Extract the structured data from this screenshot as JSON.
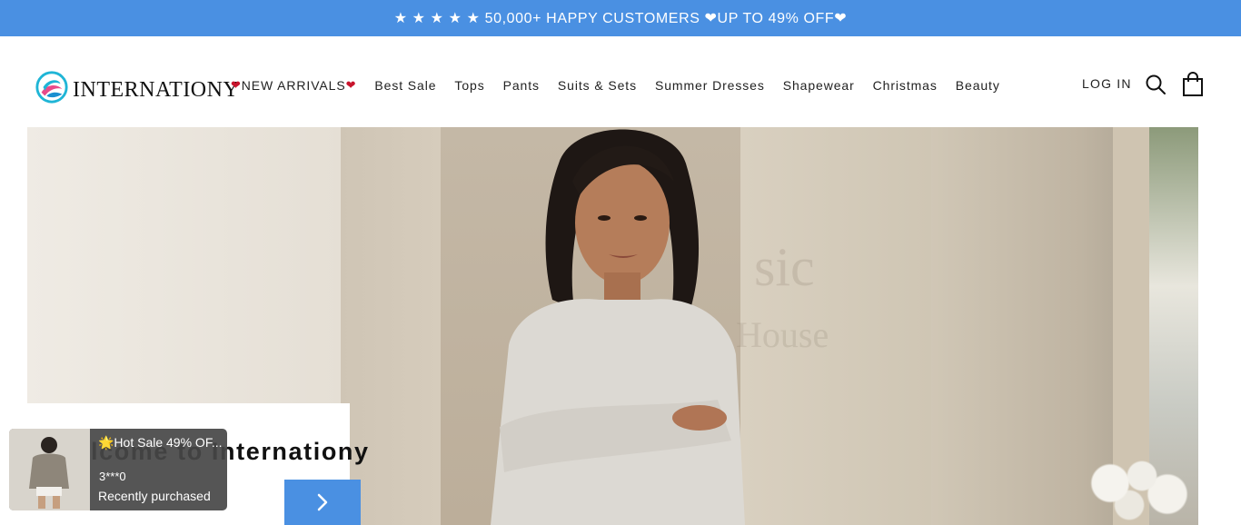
{
  "announcement": {
    "text": "★ ★ ★ ★ ★ 50,000+ HAPPY CUSTOMERS ❤UP TO 49% OFF❤"
  },
  "header": {
    "logo_text": "INTERNATIONY",
    "nav": [
      {
        "label": "NEW ARRIVALS",
        "heart_left": "❤",
        "heart_right": "❤"
      },
      {
        "label": "Best Sale"
      },
      {
        "label": "Tops"
      },
      {
        "label": "Pants"
      },
      {
        "label": "Suits & Sets"
      },
      {
        "label": "Summer Dresses"
      },
      {
        "label": "Shapewear"
      },
      {
        "label": "Christmas"
      },
      {
        "label": "Beauty"
      }
    ],
    "login_label": "LOG IN",
    "icons": {
      "search": "search-icon",
      "cart": "cart-icon"
    }
  },
  "hero": {
    "welcome_text": "lcome to Internationy",
    "watermark_line1": "sic",
    "watermark_line2": "House",
    "next_icon": "chevron-right-icon"
  },
  "popup": {
    "title": "🌟Hot Sale 49% OF...",
    "name": "3***0",
    "status": "Recently purchased"
  },
  "colors": {
    "accent": "#4a90e2",
    "heart": "#c8142c"
  }
}
